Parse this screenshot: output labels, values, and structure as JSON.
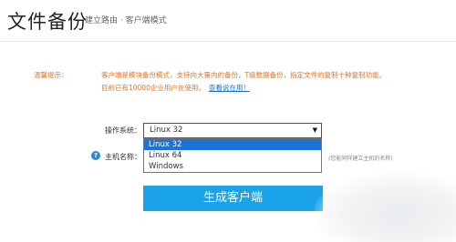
{
  "header": {
    "title": "文件备份",
    "subtitle": "建立路由 · 客户端模式"
  },
  "tip": {
    "label": "温馨提示：",
    "line1": "客户端是模块备份模式，支持向大量内的备份，T级数据备份，指定文件的复制十种复制功能。",
    "line2": "目前已有10000企业用户在使用，",
    "link": "查看说在用！"
  },
  "form": {
    "os_label": "操作系统：",
    "os_selected": "Linux 32",
    "os_options": [
      "Linux 32",
      "Linux 64",
      "Windows"
    ],
    "host_label": "主机名称：",
    "host_value": "",
    "host_hint": "(您能同样建立主机的名称)",
    "help_icon": "?",
    "submit_label": "生成客户端"
  },
  "icons": {
    "help": "help-icon",
    "dropdown": "chevron-down-icon"
  },
  "colors": {
    "accent": "#1aa3e8",
    "warning_text": "#e8731f",
    "link": "#1a72c9",
    "selected_option": "#1e73d8"
  }
}
